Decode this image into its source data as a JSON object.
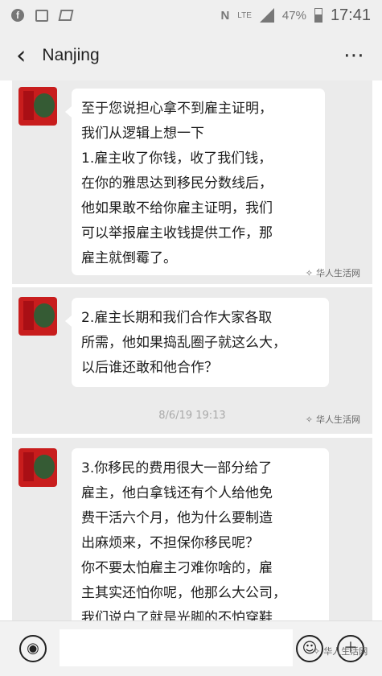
{
  "status_bar": {
    "time": "17:41",
    "battery": "47%",
    "network": "LTE",
    "icons": [
      "facebook-icon",
      "gallery-icon",
      "message-icon",
      "nfc-icon",
      "signal-icon",
      "battery-icon"
    ]
  },
  "nav": {
    "title": "Nanjing",
    "back_icon": "back-icon",
    "more_label": "⋯"
  },
  "messages": [
    {
      "lines": [
        "至于您说担心拿不到雇主证明，",
        "我们从逻辑上想一下",
        "1.雇主收了你钱，收了我们钱，",
        "在你的雅思达到移民分数线后，",
        "他如果敢不给你雇主证明，我们",
        "可以举报雇主收钱提供工作，那",
        "雇主就倒霉了。"
      ],
      "watermark": "华人生活网"
    },
    {
      "lines": [
        "2.雇主长期和我们合作大家各取",
        "所需，他如果捣乱圈子就这么大，",
        "以后谁还敢和他合作？"
      ],
      "timestamp": "8/6/19 19:13",
      "watermark": "华人生活网"
    },
    {
      "lines": [
        "3.你移民的费用很大一部分给了",
        "雇主，他白拿钱还有个人给他免",
        "费干活六个月，他为什么要制造",
        "出麻烦来，不担保你移民呢？",
        "你不要太怕雇主刁难你啥的，雇",
        "主其实还怕你呢，他那么大公司，",
        "我们说白了就是光脚的不怕穿鞋"
      ]
    }
  ],
  "input_bar": {
    "voice_icon": "voice-icon",
    "emoji_icon": "emoji-icon",
    "add_icon": "add-icon",
    "watermark": "华人生活网"
  }
}
